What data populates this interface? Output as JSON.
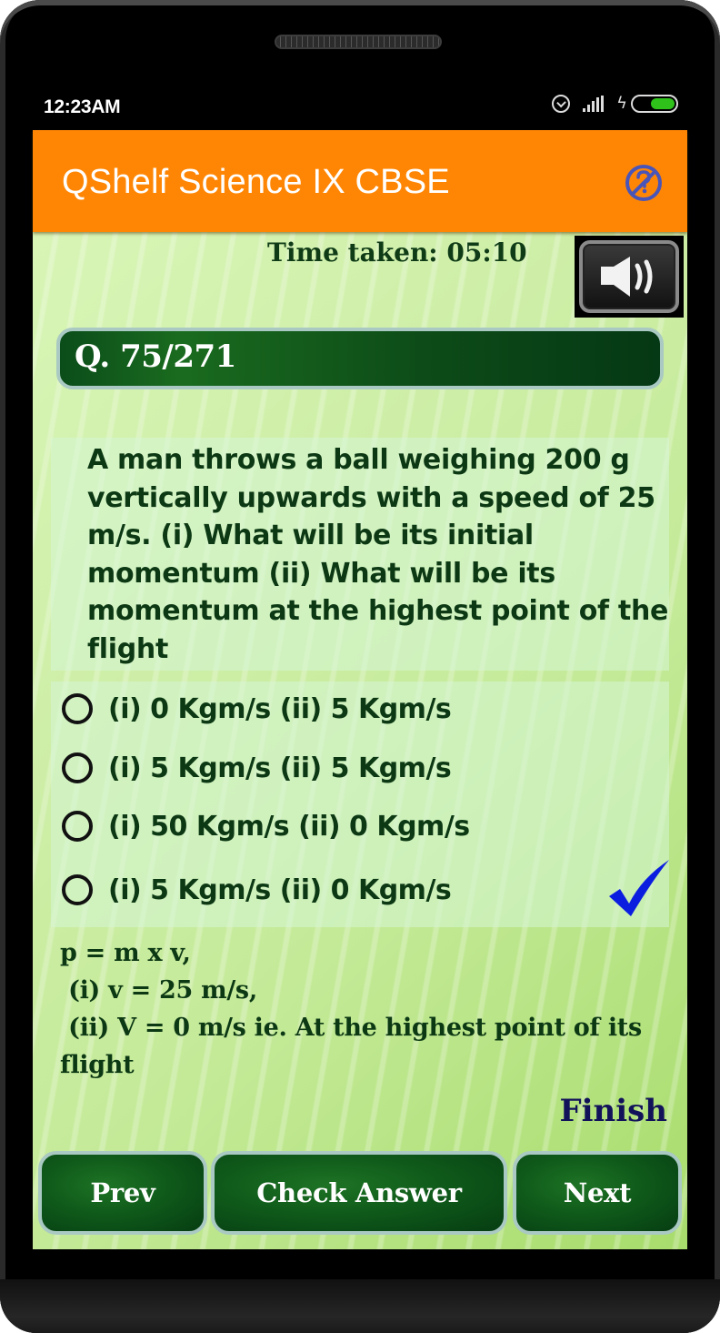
{
  "status_bar": {
    "time": "12:23AM",
    "icons": [
      "alarm-icon",
      "signal-icon",
      "charging-icon",
      "battery-icon"
    ],
    "battery_level": 0.6
  },
  "app_bar": {
    "title": "QShelf Science IX CBSE",
    "help_icon": "no-help-icon",
    "background_color": "#ff8605",
    "icon_color": "#4a55b8"
  },
  "quiz": {
    "timer_label": "Time taken: 05:10",
    "sound_icon": "speaker-icon",
    "question_number": "Q. 75/271",
    "question": "A man throws a ball weighing 200 g vertically upwards with a speed of 25 m/s. (i) What will be its initial momentum (ii) What will be its momentum at the highest point of the flight",
    "options": [
      {
        "label": "(i) 0 Kgm/s (ii) 5 Kgm/s",
        "selected": false,
        "correct": false
      },
      {
        "label": "(i) 5 Kgm/s (ii) 5 Kgm/s",
        "selected": false,
        "correct": false
      },
      {
        "label": "(i) 50 Kgm/s (ii) 0 Kgm/s",
        "selected": false,
        "correct": false
      },
      {
        "label": "(i) 5 Kgm/s (ii) 0 Kgm/s",
        "selected": false,
        "correct": true
      }
    ],
    "correct_marker_icon": "checkmark-icon",
    "correct_marker_color": "#0b1ee0",
    "explanation": "p = m x v,\n (i) v = 25 m/s,\n (ii) V = 0 m/s ie. At the highest point of its flight",
    "finish_label": "Finish"
  },
  "navigation": {
    "prev_label": "Prev",
    "check_label": "Check Answer",
    "next_label": "Next"
  }
}
